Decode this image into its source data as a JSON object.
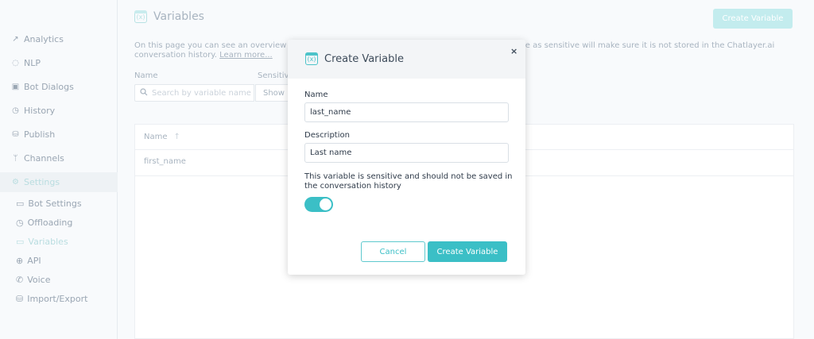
{
  "sidebar": {
    "items": [
      {
        "label": "Analytics",
        "icon": "chart-line-icon",
        "glyph": "↗"
      },
      {
        "label": "NLP",
        "icon": "chat-icon",
        "glyph": "◌"
      },
      {
        "label": "Bot Dialogs",
        "icon": "dialog-icon",
        "glyph": "▣"
      },
      {
        "label": "History",
        "icon": "clock-icon",
        "glyph": "◷"
      },
      {
        "label": "Publish",
        "icon": "publish-icon",
        "glyph": "⛁"
      },
      {
        "label": "Channels",
        "icon": "channels-icon",
        "glyph": "ᛘ"
      },
      {
        "label": "Settings",
        "icon": "gear-icon",
        "glyph": "⚙"
      }
    ],
    "subitems": [
      {
        "label": "Bot Settings",
        "icon": "bot-settings-icon",
        "glyph": "▭"
      },
      {
        "label": "Offloading",
        "icon": "offloading-icon",
        "glyph": "◷"
      },
      {
        "label": "Variables",
        "icon": "variables-icon",
        "glyph": "▭"
      },
      {
        "label": "API",
        "icon": "globe-icon",
        "glyph": "⊕"
      },
      {
        "label": "Voice",
        "icon": "voice-icon",
        "glyph": "✆"
      },
      {
        "label": "Import/Export",
        "icon": "database-icon",
        "glyph": "⛁"
      }
    ]
  },
  "page": {
    "title": "Variables",
    "title_icon": "(x)",
    "create_button": "Create Variable",
    "description_line1": "On this page you can see an overview",
    "description_line2": "conversation history.",
    "learn_more": "Learn more...",
    "description_right": "le as sensitive will make sure it is not stored in the Chatlayer.ai",
    "filter_name_label": "Name",
    "filter_sensitive_label": "Sensitiv",
    "search_placeholder": "Search by variable name",
    "show_value": "Show",
    "table": {
      "header_name": "Name",
      "sort_glyph": "↑",
      "rows": [
        "first_name"
      ]
    }
  },
  "modal": {
    "title": "Create Variable",
    "title_icon": "(x)",
    "close_glyph": "×",
    "name_label": "Name",
    "name_value": "last_name",
    "description_label": "Description",
    "description_value": "Last name",
    "sensitive_text": "This variable is sensitive and should not be saved in the conversation history",
    "sensitive_on": true,
    "cancel_label": "Cancel",
    "create_label": "Create Variable"
  },
  "colors": {
    "accent": "#3bbfc6",
    "accent_faded": "#c3ecee",
    "text": "#2f3b4a",
    "muted": "#a8b4c0"
  }
}
